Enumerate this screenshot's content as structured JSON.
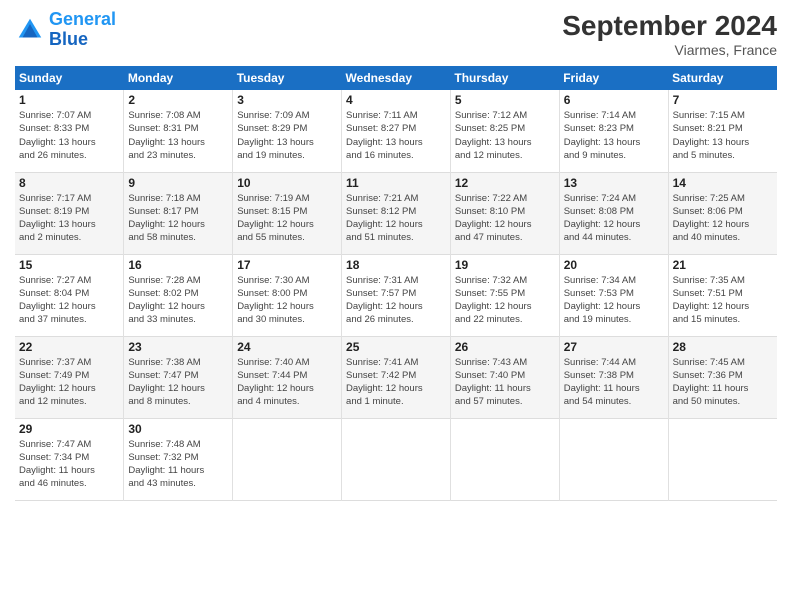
{
  "header": {
    "logo_line1": "General",
    "logo_line2": "Blue",
    "month": "September 2024",
    "location": "Viarmes, France"
  },
  "weekdays": [
    "Sunday",
    "Monday",
    "Tuesday",
    "Wednesday",
    "Thursday",
    "Friday",
    "Saturday"
  ],
  "weeks": [
    [
      {
        "day": "1",
        "info": "Sunrise: 7:07 AM\nSunset: 8:33 PM\nDaylight: 13 hours\nand 26 minutes."
      },
      {
        "day": "2",
        "info": "Sunrise: 7:08 AM\nSunset: 8:31 PM\nDaylight: 13 hours\nand 23 minutes."
      },
      {
        "day": "3",
        "info": "Sunrise: 7:09 AM\nSunset: 8:29 PM\nDaylight: 13 hours\nand 19 minutes."
      },
      {
        "day": "4",
        "info": "Sunrise: 7:11 AM\nSunset: 8:27 PM\nDaylight: 13 hours\nand 16 minutes."
      },
      {
        "day": "5",
        "info": "Sunrise: 7:12 AM\nSunset: 8:25 PM\nDaylight: 13 hours\nand 12 minutes."
      },
      {
        "day": "6",
        "info": "Sunrise: 7:14 AM\nSunset: 8:23 PM\nDaylight: 13 hours\nand 9 minutes."
      },
      {
        "day": "7",
        "info": "Sunrise: 7:15 AM\nSunset: 8:21 PM\nDaylight: 13 hours\nand 5 minutes."
      }
    ],
    [
      {
        "day": "8",
        "info": "Sunrise: 7:17 AM\nSunset: 8:19 PM\nDaylight: 13 hours\nand 2 minutes."
      },
      {
        "day": "9",
        "info": "Sunrise: 7:18 AM\nSunset: 8:17 PM\nDaylight: 12 hours\nand 58 minutes."
      },
      {
        "day": "10",
        "info": "Sunrise: 7:19 AM\nSunset: 8:15 PM\nDaylight: 12 hours\nand 55 minutes."
      },
      {
        "day": "11",
        "info": "Sunrise: 7:21 AM\nSunset: 8:12 PM\nDaylight: 12 hours\nand 51 minutes."
      },
      {
        "day": "12",
        "info": "Sunrise: 7:22 AM\nSunset: 8:10 PM\nDaylight: 12 hours\nand 47 minutes."
      },
      {
        "day": "13",
        "info": "Sunrise: 7:24 AM\nSunset: 8:08 PM\nDaylight: 12 hours\nand 44 minutes."
      },
      {
        "day": "14",
        "info": "Sunrise: 7:25 AM\nSunset: 8:06 PM\nDaylight: 12 hours\nand 40 minutes."
      }
    ],
    [
      {
        "day": "15",
        "info": "Sunrise: 7:27 AM\nSunset: 8:04 PM\nDaylight: 12 hours\nand 37 minutes."
      },
      {
        "day": "16",
        "info": "Sunrise: 7:28 AM\nSunset: 8:02 PM\nDaylight: 12 hours\nand 33 minutes."
      },
      {
        "day": "17",
        "info": "Sunrise: 7:30 AM\nSunset: 8:00 PM\nDaylight: 12 hours\nand 30 minutes."
      },
      {
        "day": "18",
        "info": "Sunrise: 7:31 AM\nSunset: 7:57 PM\nDaylight: 12 hours\nand 26 minutes."
      },
      {
        "day": "19",
        "info": "Sunrise: 7:32 AM\nSunset: 7:55 PM\nDaylight: 12 hours\nand 22 minutes."
      },
      {
        "day": "20",
        "info": "Sunrise: 7:34 AM\nSunset: 7:53 PM\nDaylight: 12 hours\nand 19 minutes."
      },
      {
        "day": "21",
        "info": "Sunrise: 7:35 AM\nSunset: 7:51 PM\nDaylight: 12 hours\nand 15 minutes."
      }
    ],
    [
      {
        "day": "22",
        "info": "Sunrise: 7:37 AM\nSunset: 7:49 PM\nDaylight: 12 hours\nand 12 minutes."
      },
      {
        "day": "23",
        "info": "Sunrise: 7:38 AM\nSunset: 7:47 PM\nDaylight: 12 hours\nand 8 minutes."
      },
      {
        "day": "24",
        "info": "Sunrise: 7:40 AM\nSunset: 7:44 PM\nDaylight: 12 hours\nand 4 minutes."
      },
      {
        "day": "25",
        "info": "Sunrise: 7:41 AM\nSunset: 7:42 PM\nDaylight: 12 hours\nand 1 minute."
      },
      {
        "day": "26",
        "info": "Sunrise: 7:43 AM\nSunset: 7:40 PM\nDaylight: 11 hours\nand 57 minutes."
      },
      {
        "day": "27",
        "info": "Sunrise: 7:44 AM\nSunset: 7:38 PM\nDaylight: 11 hours\nand 54 minutes."
      },
      {
        "day": "28",
        "info": "Sunrise: 7:45 AM\nSunset: 7:36 PM\nDaylight: 11 hours\nand 50 minutes."
      }
    ],
    [
      {
        "day": "29",
        "info": "Sunrise: 7:47 AM\nSunset: 7:34 PM\nDaylight: 11 hours\nand 46 minutes."
      },
      {
        "day": "30",
        "info": "Sunrise: 7:48 AM\nSunset: 7:32 PM\nDaylight: 11 hours\nand 43 minutes."
      },
      {
        "day": "",
        "info": ""
      },
      {
        "day": "",
        "info": ""
      },
      {
        "day": "",
        "info": ""
      },
      {
        "day": "",
        "info": ""
      },
      {
        "day": "",
        "info": ""
      }
    ]
  ]
}
